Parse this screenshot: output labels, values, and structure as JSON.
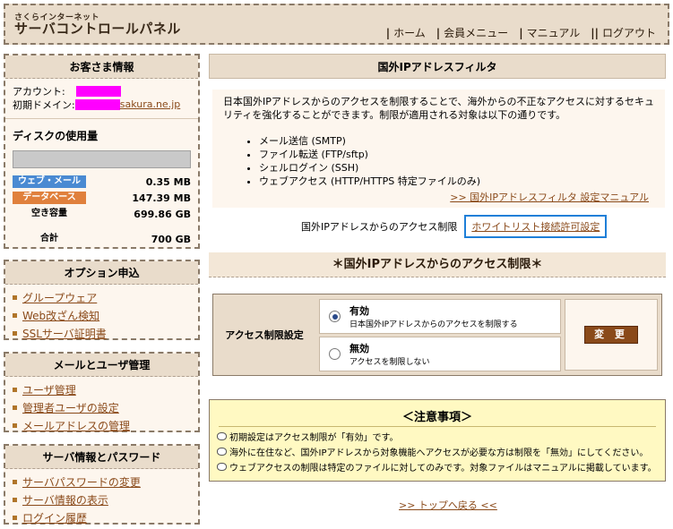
{
  "header": {
    "logo_small": "さくらインターネット",
    "logo_big": "サーバコントロールパネル",
    "nav": [
      {
        "label": "ホーム"
      },
      {
        "label": "会員メニュー"
      },
      {
        "label": "マニュアル"
      },
      {
        "label": "ログアウト"
      }
    ]
  },
  "guest": {
    "title": "お客さま情報",
    "account_label": "アカウント:",
    "domain_label": "初期ドメイン:",
    "domain_suffix": "sakura.ne.jp",
    "disk_title": "ディスクの使用量",
    "rows": [
      {
        "label": "ウェブ・メール",
        "value": "0.35 MB"
      },
      {
        "label": "データベース",
        "value": "147.39 MB"
      },
      {
        "label": "空き容量",
        "value": "699.86 GB"
      },
      {
        "label": "合計",
        "value": "700 GB"
      }
    ]
  },
  "option": {
    "title": "オプション申込",
    "items": [
      "グループウェア",
      "Web改ざん検知",
      "SSLサーバ証明書"
    ]
  },
  "mail": {
    "title": "メールとユーザ管理",
    "items": [
      "ユーザ管理",
      "管理者ユーザの設定",
      "メールアドレスの管理"
    ]
  },
  "server": {
    "title": "サーバ情報とパスワード",
    "items": [
      "サーバパスワードの変更",
      "サーバ情報の表示",
      "ログイン履歴"
    ]
  },
  "main": {
    "title": "国外IPアドレスフィルタ",
    "description": "日本国外IPアドレスからのアクセスを制限することで、海外からの不正なアクセスに対するセキュリティを強化することができます。制限が適用される対象は以下の通りです。",
    "targets": [
      "メール送信 (SMTP)",
      "ファイル転送 (FTP/sftp)",
      "シェルログイン (SSH)",
      "ウェブアクセス (HTTP/HTTPS 特定ファイルのみ)"
    ],
    "manual_link": ">> 国外IPアドレスフィルタ 設定マニュアル",
    "filter_label": "国外IPアドレスからのアクセス制限",
    "whitelist_link": "ホワイトリスト接続許可設定",
    "section_title": "＊国外IPアドレスからのアクセス制限＊",
    "setting_label": "アクセス制限設定",
    "option_on_title": "有効",
    "option_on_desc": "日本国外IPアドレスからのアクセスを制限する",
    "option_off_title": "無効",
    "option_off_desc": "アクセスを制限しない",
    "change_button": "変 更"
  },
  "notice": {
    "title": "＜注意事項＞",
    "lines": [
      "初期設定はアクセス制限が「有効」です。",
      "海外に在住など、国外IPアドレスから対象機能へアクセスが必要な方は制限を「無効」にしてください。",
      "ウェブアクセスの制限は特定のファイルに対してのみです。対象ファイルはマニュアルに掲載しています。"
    ]
  },
  "footer": {
    "top_link": ">> トップへ戻る <<"
  }
}
